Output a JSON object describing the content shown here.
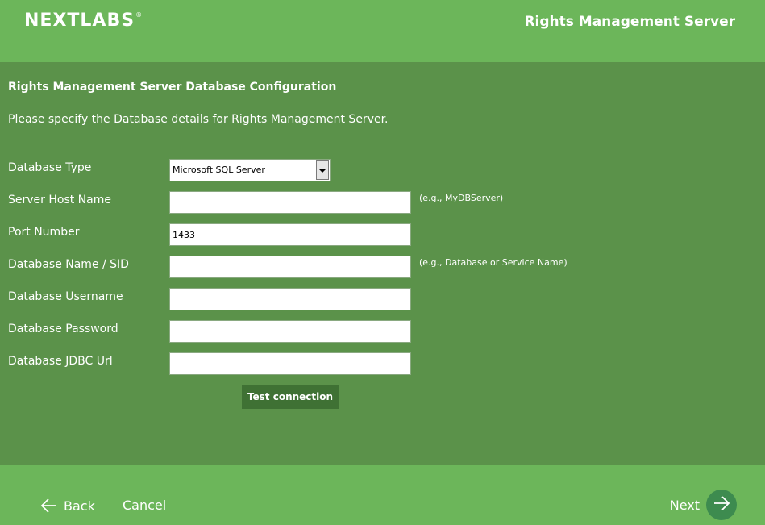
{
  "header": {
    "logo_text": "NEXTLABS",
    "logo_mark": "®",
    "app_title": "Rights Management Server"
  },
  "page": {
    "section_title": "Rights Management Server Database Configuration",
    "intro": "Please specify the Database details for Rights Management Server."
  },
  "form": {
    "db_type": {
      "label": "Database Type",
      "value": "Microsoft SQL Server"
    },
    "host": {
      "label": "Server Host Name",
      "value": "",
      "hint": "(e.g., MyDBServer)"
    },
    "port": {
      "label": "Port Number",
      "value": "1433"
    },
    "db_name": {
      "label": "Database Name / SID",
      "value": "",
      "hint": "(e.g., Database or Service Name)"
    },
    "username": {
      "label": "Database Username",
      "value": ""
    },
    "password": {
      "label": "Database Password",
      "value": ""
    },
    "jdbc_url": {
      "label": "Database JDBC Url",
      "value": ""
    },
    "test_button": "Test connection"
  },
  "footer": {
    "back": "Back",
    "cancel": "Cancel",
    "next": "Next"
  },
  "colors": {
    "header_green": "#6cb65a",
    "content_green": "#5b924a",
    "button_dark_green": "#3f7134",
    "next_circle": "#3d8b4f"
  },
  "icons": {
    "back": "arrow-left-icon",
    "next": "arrow-right-icon",
    "dropdown": "chevron-down-icon"
  }
}
